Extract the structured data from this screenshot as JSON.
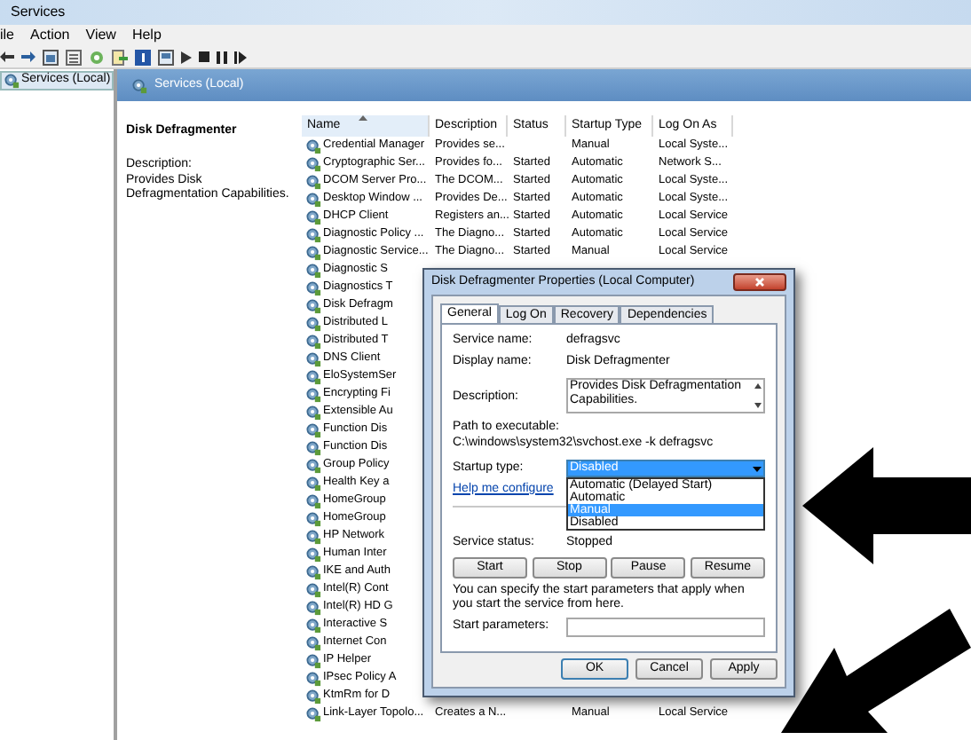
{
  "window": {
    "title": "Services"
  },
  "menu": [
    "ile",
    "Action",
    "View",
    "Help"
  ],
  "tree": {
    "items": [
      {
        "label": "Services (Local)",
        "selected": true
      }
    ]
  },
  "pane_header": "Services (Local)",
  "details": {
    "title": "Disk Defragmenter",
    "description_label": "Description:",
    "description": "Provides Disk Defragmentation Capabilities."
  },
  "table": {
    "columns": [
      "Name",
      "Description",
      "Status",
      "Startup Type",
      "Log On As"
    ],
    "rows": [
      {
        "name": "Credential Manager",
        "description": "Provides se...",
        "status": "",
        "startup_type": "Manual",
        "log_on_as": "Local Syste..."
      },
      {
        "name": "Cryptographic Ser...",
        "description": "Provides fo...",
        "status": "Started",
        "startup_type": "Automatic",
        "log_on_as": "Network S..."
      },
      {
        "name": "DCOM Server Pro...",
        "description": "The DCOM...",
        "status": "Started",
        "startup_type": "Automatic",
        "log_on_as": "Local Syste..."
      },
      {
        "name": "Desktop Window ...",
        "description": "Provides De...",
        "status": "Started",
        "startup_type": "Automatic",
        "log_on_as": "Local Syste..."
      },
      {
        "name": "DHCP Client",
        "description": "Registers an...",
        "status": "Started",
        "startup_type": "Automatic",
        "log_on_as": "Local Service"
      },
      {
        "name": "Diagnostic Policy ...",
        "description": "The Diagno...",
        "status": "Started",
        "startup_type": "Automatic",
        "log_on_as": "Local Service"
      },
      {
        "name": "Diagnostic Service...",
        "description": "The Diagno...",
        "status": "Started",
        "startup_type": "Manual",
        "log_on_as": "Local Service"
      },
      {
        "name": "Diagnostic S"
      },
      {
        "name": "Diagnostics T"
      },
      {
        "name": "Disk Defragm"
      },
      {
        "name": "Distributed L"
      },
      {
        "name": "Distributed T"
      },
      {
        "name": "DNS Client"
      },
      {
        "name": "EloSystemSer"
      },
      {
        "name": "Encrypting Fi"
      },
      {
        "name": "Extensible Au"
      },
      {
        "name": "Function Dis"
      },
      {
        "name": "Function Dis"
      },
      {
        "name": "Group Policy"
      },
      {
        "name": "Health Key a"
      },
      {
        "name": "HomeGroup"
      },
      {
        "name": "HomeGroup"
      },
      {
        "name": "HP Network"
      },
      {
        "name": "Human Inter"
      },
      {
        "name": "IKE and Auth"
      },
      {
        "name": "Intel(R) Cont"
      },
      {
        "name": "Intel(R) HD G"
      },
      {
        "name": "Interactive S"
      },
      {
        "name": "Internet Con"
      },
      {
        "name": "IP Helper"
      },
      {
        "name": "IPsec Policy A"
      },
      {
        "name": "KtmRm for D"
      },
      {
        "name": "Link-Layer Topolo...",
        "description": "Creates a N...",
        "status": "",
        "startup_type": "Manual",
        "log_on_as": "Local Service"
      }
    ]
  },
  "dialog": {
    "title": "Disk Defragmenter Properties (Local Computer)",
    "tabs": [
      {
        "label": "General",
        "selected": true
      },
      {
        "label": "Log On",
        "selected": false
      },
      {
        "label": "Recovery",
        "selected": false
      },
      {
        "label": "Dependencies",
        "selected": false
      }
    ],
    "service_name_label": "Service name:",
    "service_name": "defragsvc",
    "display_name_label": "Display name:",
    "display_name": "Disk Defragmenter",
    "description_label": "Description:",
    "description": "Provides Disk Defragmentation Capabilities.",
    "path_label": "Path to executable:",
    "path": "C:\\windows\\system32\\svchost.exe -k defragsvc",
    "startup_type_label": "Startup type:",
    "startup_type": "Disabled",
    "startup_options": [
      {
        "label": "Automatic (Delayed Start)",
        "selected": false
      },
      {
        "label": "Automatic",
        "selected": false
      },
      {
        "label": "Manual",
        "selected": true
      },
      {
        "label": "Disabled",
        "selected": false
      }
    ],
    "help_link": "Help me configure",
    "service_status_label": "Service status:",
    "service_status": "Stopped",
    "control_buttons": [
      "Start",
      "Stop",
      "Pause",
      "Resume"
    ],
    "hint": "You can specify the start parameters that apply when you start the service from here.",
    "start_parameters_label": "Start parameters:",
    "buttons": [
      "OK",
      "Cancel",
      "Apply"
    ]
  }
}
